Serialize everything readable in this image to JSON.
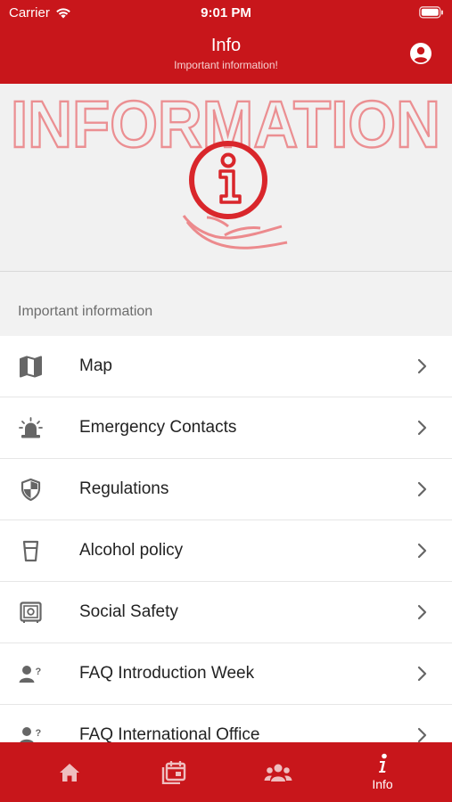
{
  "status_bar": {
    "carrier": "Carrier",
    "time": "9:01 PM"
  },
  "header": {
    "title": "Info",
    "subtitle": "Important information!",
    "account_icon": "account-circle-icon"
  },
  "banner": {
    "headline": "INFORMATION",
    "icon": "info-hand-icon",
    "color": "#e23a3f"
  },
  "section": {
    "title": "Important information"
  },
  "items": [
    {
      "label": "Map",
      "icon": "map-icon"
    },
    {
      "label": "Emergency Contacts",
      "icon": "siren-icon"
    },
    {
      "label": "Regulations",
      "icon": "shield-icon"
    },
    {
      "label": "Alcohol policy",
      "icon": "glass-icon"
    },
    {
      "label": "Social Safety",
      "icon": "safe-icon"
    },
    {
      "label": "FAQ Introduction Week",
      "icon": "person-question-icon"
    },
    {
      "label": "FAQ International Office",
      "icon": "person-question-icon"
    }
  ],
  "tabs": [
    {
      "icon": "home-icon",
      "label": ""
    },
    {
      "icon": "calendar-icon",
      "label": ""
    },
    {
      "icon": "people-icon",
      "label": ""
    },
    {
      "icon": "info-icon",
      "label": "Info",
      "active": true
    }
  ],
  "colors": {
    "brand_red": "#c8161b",
    "text": "#222222",
    "secondary_text": "#6d6d6d"
  }
}
